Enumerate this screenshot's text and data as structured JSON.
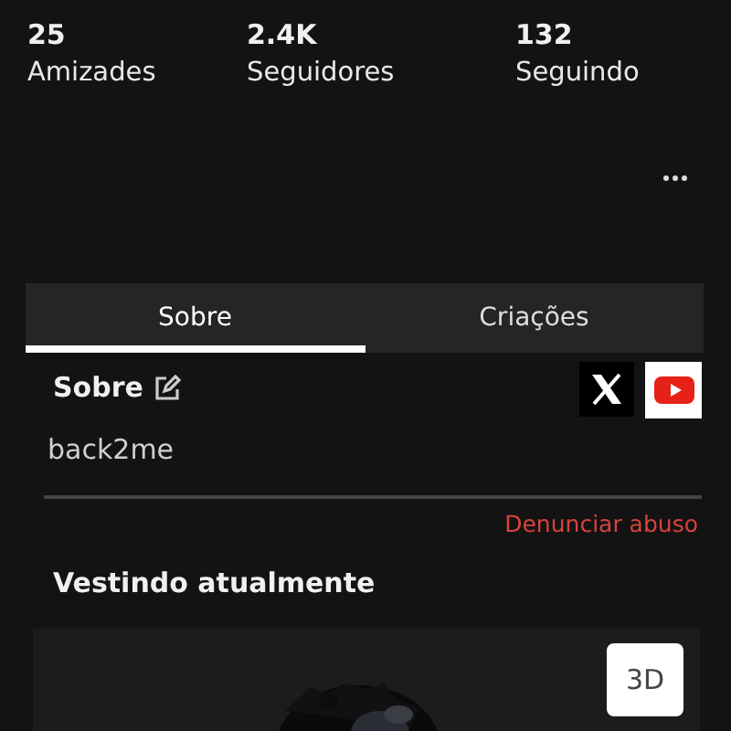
{
  "stats": [
    {
      "value": "25",
      "label": "Amizades"
    },
    {
      "value": "2.4K",
      "label": "Seguidores"
    },
    {
      "value": "132",
      "label": "Seguindo"
    }
  ],
  "tabs": [
    {
      "label": "Sobre",
      "selected": true
    },
    {
      "label": "Criações",
      "selected": false
    }
  ],
  "about": {
    "title": "Sobre",
    "text": "back2me",
    "social": [
      {
        "kind": "x"
      },
      {
        "kind": "youtube"
      }
    ],
    "report": "Denunciar abuso"
  },
  "wearing": {
    "title": "Vestindo atualmente",
    "view_button": "3D"
  }
}
